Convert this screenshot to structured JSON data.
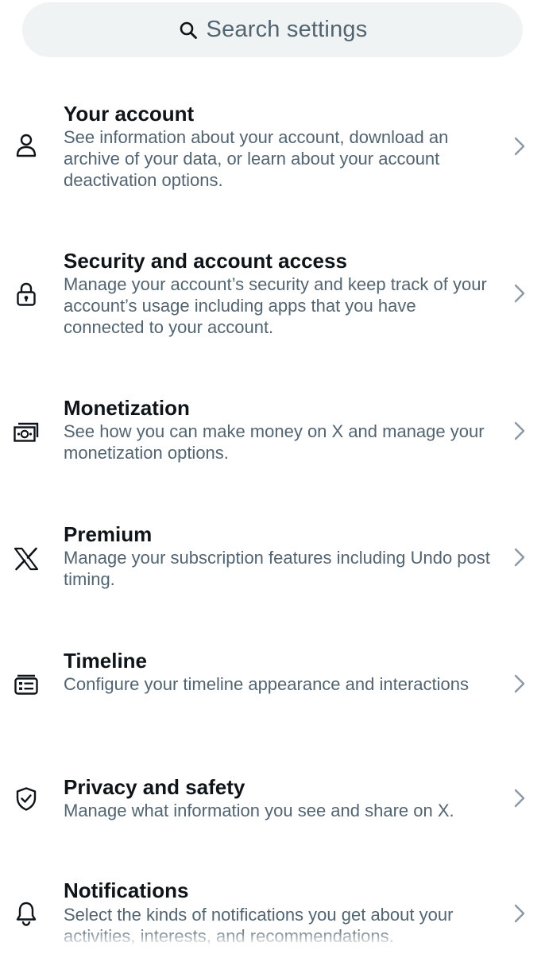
{
  "search": {
    "placeholder": "Search settings"
  },
  "items": [
    {
      "icon": "person-icon",
      "title": "Your account",
      "description": "See information about your account, download an archive of your data, or learn about your account deactivation options."
    },
    {
      "icon": "lock-icon",
      "title": "Security and account access",
      "description": "Manage your account’s security and keep track of your account’s usage including apps that you have connected to your account."
    },
    {
      "icon": "money-icon",
      "title": "Monetization",
      "description": "See how you can make money on X and manage your monetization options."
    },
    {
      "icon": "x-logo-icon",
      "title": "Premium",
      "description": "Manage your subscription features including Undo post timing."
    },
    {
      "icon": "timeline-icon",
      "title": "Timeline",
      "description": "Configure your timeline appearance and interactions"
    },
    {
      "icon": "shield-check-icon",
      "title": "Privacy and safety",
      "description": "Manage what information you see and share on X."
    },
    {
      "icon": "bell-icon",
      "title": "Notifications",
      "description": "Select the kinds of notifications you get about your activities, interests, and recommendations."
    }
  ],
  "colors": {
    "primary_text": "#0f1419",
    "secondary_text": "#536471",
    "search_background": "#eff3f4",
    "chevron": "#8b98a5"
  }
}
